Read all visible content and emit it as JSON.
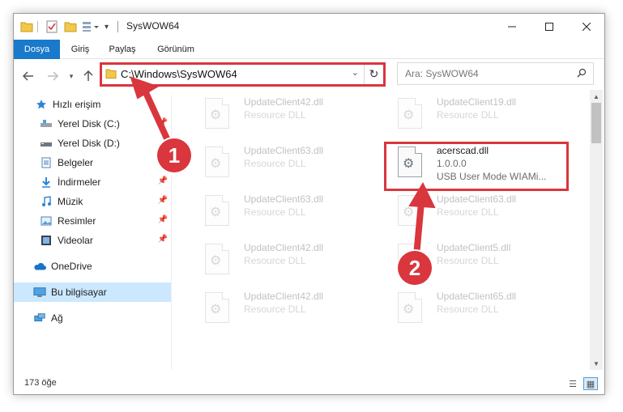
{
  "window": {
    "title": "SysWOW64"
  },
  "ribbon": {
    "tabs": [
      {
        "label": "Dosya",
        "active": true
      },
      {
        "label": "Giriş",
        "active": false
      },
      {
        "label": "Paylaş",
        "active": false
      },
      {
        "label": "Görünüm",
        "active": false
      }
    ]
  },
  "address": {
    "path": "C:\\Windows\\SysWOW64"
  },
  "search": {
    "placeholder": "Ara: SysWOW64"
  },
  "sidebar": {
    "items": [
      {
        "label": "Hızlı erişim",
        "icon": "star-icon"
      },
      {
        "label": "Yerel Disk (C:)",
        "icon": "drive-icon"
      },
      {
        "label": "Yerel Disk (D:)",
        "icon": "drive-icon"
      },
      {
        "label": "Belgeler",
        "icon": "documents-icon"
      },
      {
        "label": "İndirmeler",
        "icon": "download-icon"
      },
      {
        "label": "Müzik",
        "icon": "music-icon"
      },
      {
        "label": "Resimler",
        "icon": "pictures-icon"
      },
      {
        "label": "Videolar",
        "icon": "videos-icon"
      },
      {
        "label": "OneDrive",
        "icon": "cloud-icon"
      },
      {
        "label": "Bu bilgisayar",
        "icon": "computer-icon"
      },
      {
        "label": "Ağ",
        "icon": "network-icon"
      }
    ]
  },
  "files": [
    {
      "name": "UpdateClient42.dll",
      "type": "Resource DLL"
    },
    {
      "name": "UpdateClient19.dll",
      "type": "Resource DLL"
    },
    {
      "name": "UpdateClient63.dll",
      "type": "Resource DLL"
    },
    {
      "name": "acerscad.dll",
      "type": "1.0.0.0",
      "sub": "USB User Mode WIAMi..."
    },
    {
      "name": "UpdateClient63.dll",
      "type": "Resource DLL"
    },
    {
      "name": "UpdateClient63.dll",
      "type": "Resource DLL"
    },
    {
      "name": "UpdateClient42.dll",
      "type": "Resource DLL"
    },
    {
      "name": "UpdateClient5.dll",
      "type": "Resource DLL"
    },
    {
      "name": "UpdateClient42.dll",
      "type": "Resource DLL"
    },
    {
      "name": "UpdateClient65.dll",
      "type": "Resource DLL"
    }
  ],
  "status": {
    "count": "173 öğe"
  },
  "callouts": {
    "one": "1",
    "two": "2"
  },
  "colors": {
    "accent": "#1979ca",
    "highlight": "#d9363e",
    "selected": "#cce8ff"
  }
}
